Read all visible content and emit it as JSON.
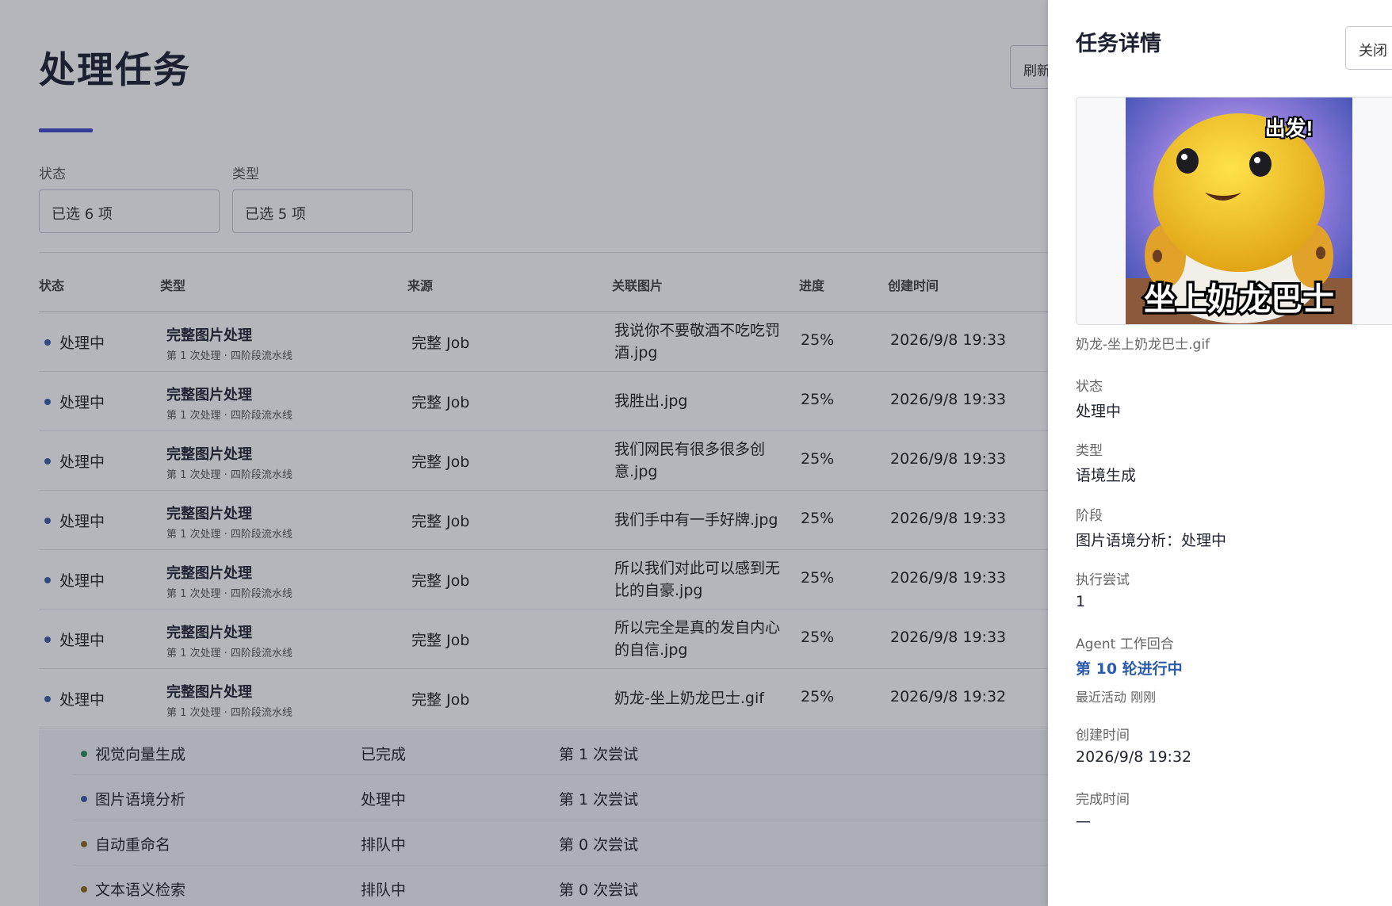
{
  "page": {
    "title": "处理任务",
    "refresh_label": "刷新"
  },
  "filters": {
    "status_label": "状态",
    "status_value": "已选 6 项",
    "type_label": "类型",
    "type_value": "已选 5 项"
  },
  "table": {
    "headers": [
      "状态",
      "类型",
      "来源",
      "关联图片",
      "进度",
      "创建时间"
    ],
    "rows": [
      {
        "status": "处理中",
        "type": "完整图片处理",
        "type_sub": "第 1 次处理 · 四阶段流水线",
        "source": "完整 Job",
        "image": "我说你不要敬酒不吃吃罚酒.jpg",
        "progress": "25%",
        "created": "2026/9/8 19:33"
      },
      {
        "status": "处理中",
        "type": "完整图片处理",
        "type_sub": "第 1 次处理 · 四阶段流水线",
        "source": "完整 Job",
        "image": "我胜出.jpg",
        "progress": "25%",
        "created": "2026/9/8 19:33"
      },
      {
        "status": "处理中",
        "type": "完整图片处理",
        "type_sub": "第 1 次处理 · 四阶段流水线",
        "source": "完整 Job",
        "image": "我们网民有很多很多创意.jpg",
        "progress": "25%",
        "created": "2026/9/8 19:33"
      },
      {
        "status": "处理中",
        "type": "完整图片处理",
        "type_sub": "第 1 次处理 · 四阶段流水线",
        "source": "完整 Job",
        "image": "我们手中有一手好牌.jpg",
        "progress": "25%",
        "created": "2026/9/8 19:33"
      },
      {
        "status": "处理中",
        "type": "完整图片处理",
        "type_sub": "第 1 次处理 · 四阶段流水线",
        "source": "完整 Job",
        "image": "所以我们对此可以感到无比的自豪.jpg",
        "progress": "25%",
        "created": "2026/9/8 19:33"
      },
      {
        "status": "处理中",
        "type": "完整图片处理",
        "type_sub": "第 1 次处理 · 四阶段流水线",
        "source": "完整 Job",
        "image": "所以完全是真的发自内心的自信.jpg",
        "progress": "25%",
        "created": "2026/9/8 19:33"
      },
      {
        "status": "处理中",
        "type": "完整图片处理",
        "type_sub": "第 1 次处理 · 四阶段流水线",
        "source": "完整 Job",
        "image": "奶龙-坐上奶龙巴士.gif",
        "progress": "25%",
        "created": "2026/9/8 19:32"
      }
    ],
    "subtasks": [
      {
        "name": "视觉向量生成",
        "state": "已完成",
        "tries": "第 1 次尝试",
        "color": "#2f8a5a"
      },
      {
        "name": "图片语境分析",
        "state": "处理中",
        "tries": "第 1 次尝试",
        "color": "#3a5fa8"
      },
      {
        "name": "自动重命名",
        "state": "排队中",
        "tries": "第 0 次尝试",
        "color": "#8a6a1e"
      },
      {
        "name": "文本语义检索",
        "state": "排队中",
        "tries": "第 0 次尝试",
        "color": "#8a6a1e"
      }
    ]
  },
  "drawer": {
    "title": "任务详情",
    "close_label": "关闭",
    "preview": {
      "caption": "奶龙-坐上奶龙巴士.gif",
      "overlay_top": "出发!",
      "overlay_bottom": "坐上奶龙巴士"
    },
    "fields": {
      "status_label": "状态",
      "status_value": "处理中",
      "type_label": "类型",
      "type_value": "语境生成",
      "stage_label": "阶段",
      "stage_value": "图片语境分析：处理中",
      "attempts_label": "执行尝试",
      "attempts_value": "1",
      "agent_label": "Agent 工作回合",
      "agent_value": "第 10 轮进行中",
      "agent_note": "最近活动 刚刚",
      "created_label": "创建时间",
      "created_value": "2026/9/8 19:32",
      "finished_label": "完成时间",
      "finished_value": "—"
    }
  },
  "colors": {
    "accent": "#3f4ac8",
    "status_processing": "#3a5fa8",
    "status_done": "#2f8a5a",
    "status_queued": "#8a6a1e",
    "link": "#2b5cab"
  }
}
